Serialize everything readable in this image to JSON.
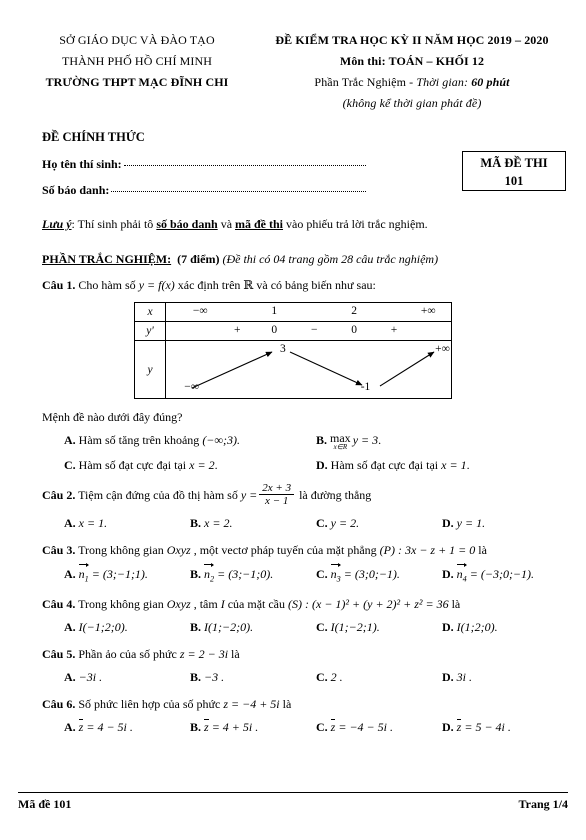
{
  "header": {
    "left": [
      "SỞ GIÁO DỤC VÀ ĐÀO TẠO",
      "THÀNH PHỐ HỒ CHÍ MINH",
      "TRƯỜNG THPT MẠC ĐĨNH CHI"
    ],
    "right_title": "ĐỀ KIỂM TRA HỌC KỲ II NĂM HỌC 2019 – 2020",
    "right_subject": "Môn thi: TOÁN – KHỐI 12",
    "right_part_label": "Phần Trắc Nghiệm",
    "right_part_sep": " - ",
    "right_time_label": "Thời gian:",
    "right_time_value": "60 phút",
    "right_note": "(không kể thời gian phát đề)",
    "official_label": "ĐỀ CHÍNH THỨC"
  },
  "student_info": {
    "name_label": "Họ tên thí sinh:",
    "name_value": "",
    "sbd_label": "Số báo danh:",
    "sbd_value": "",
    "code_box_title": "MÃ ĐỀ THI",
    "code_box_value": "101"
  },
  "note": {
    "prefix": "Lưu ý",
    "text_1": ": Thí sinh phải tô ",
    "bold_1": "số báo danh",
    "text_2": " và ",
    "bold_2": "mã đề thi",
    "text_3": " vào phiếu trả lời trắc nghiệm."
  },
  "section": {
    "title": "PHẦN TRẮC NGHIỆM:",
    "points": "(7 điểm)",
    "detail": "(Đề thi có 04 trang gồm 28 câu trắc nghiệm)"
  },
  "questions": {
    "q1": {
      "number": "Câu 1.",
      "stem_a": " Cho hàm số ",
      "stem_fn": "y = f(x)",
      "stem_b": " xác định trên ",
      "stem_set": "ℝ",
      "stem_c": " và có bảng biến như sau:",
      "prompt": "Mệnh đề nào dưới đây đúng?",
      "optA_label": "A.",
      "optA_text": " Hàm số tăng trên khoảng ",
      "optA_math": "(−∞;3).",
      "optB_label": "B.",
      "optB_max": "max",
      "optB_sub": "x∈R",
      "optB_math": "y = 3",
      "optB_dot": ".",
      "optC_label": "C.",
      "optC_text": " Hàm số đạt cực đại tại ",
      "optC_math": "x = 2",
      "optC_dot": ".",
      "optD_label": "D.",
      "optD_text": " Hàm số đạt cực đại tại ",
      "optD_math": "x = 1",
      "optD_dot": "."
    },
    "variation_table": {
      "row_labels": [
        "x",
        "y'",
        "y"
      ],
      "x_values": [
        "−∞",
        "1",
        "2",
        "+∞"
      ],
      "yprime_values": [
        "+",
        "0",
        "−",
        "0",
        "+"
      ],
      "y_points": [
        {
          "label": "−∞",
          "pos": "left-bottom"
        },
        {
          "label": "3",
          "pos": "mid-top"
        },
        {
          "label": "-1",
          "pos": "mid-bottom"
        },
        {
          "label": "+∞",
          "pos": "right-top"
        }
      ]
    },
    "q2": {
      "number": "Câu 2.",
      "stem_a": " Tiệm cận đứng của đồ thị hàm số ",
      "stem_y": "y =",
      "frac_num": "2x + 3",
      "frac_den": "x − 1",
      "stem_b": " là đường thẳng",
      "options": [
        "x = 1.",
        "x = 2.",
        "y = 2.",
        "y = 1."
      ],
      "labels": [
        "A.",
        "B.",
        "C.",
        "D."
      ]
    },
    "q3": {
      "number": "Câu 3.",
      "stem_a": " Trong không gian ",
      "stem_space": "Oxyz",
      "stem_b": " , một vectơ pháp tuyến của mặt phẳng ",
      "stem_plane": "(P) : 3x − z + 1 = 0",
      "stem_c": " là",
      "labels": [
        "A.",
        "B.",
        "C.",
        "D."
      ],
      "vec_name": "n",
      "vec_subs": [
        "1",
        "2",
        "3",
        "4"
      ],
      "vec_values": [
        "= (3;−1;1).",
        "= (3;−1;0).",
        "= (3;0;−1).",
        "= (−3;0;−1)."
      ]
    },
    "q4": {
      "number": "Câu 4.",
      "stem_a": " Trong không gian ",
      "stem_space": "Oxyz",
      "stem_b": " , tâm ",
      "stem_I": "I",
      "stem_c": " của mặt cầu ",
      "stem_sphere": "(S) : (x − 1)² + (y + 2)² + z² = 36",
      "stem_d": " là",
      "labels": [
        "A.",
        "B.",
        "C.",
        "D."
      ],
      "options": [
        "I(−1;2;0).",
        "I(1;−2;0).",
        "I(1;−2;1).",
        "I(1;2;0)."
      ]
    },
    "q5": {
      "number": "Câu 5.",
      "stem_a": " Phần ảo của số phức ",
      "stem_z": "z = 2 − 3i",
      "stem_b": " là",
      "labels": [
        "A.",
        "B.",
        "C.",
        "D."
      ],
      "options": [
        "−3i .",
        "−3 .",
        "2 .",
        "3i ."
      ]
    },
    "q6": {
      "number": "Câu 6.",
      "stem_a": " Số phức liên hợp của số phức ",
      "stem_z": "z = −4 + 5i",
      "stem_b": " là",
      "labels": [
        "A.",
        "B.",
        "C.",
        "D."
      ],
      "conj_symbol": "z",
      "options": [
        "= 4 − 5i .",
        "= 4 + 5i .",
        "= −4 − 5i .",
        "= 5 − 4i ."
      ]
    }
  },
  "footer": {
    "left": "Mã đề 101",
    "right": "Trang 1/4"
  }
}
